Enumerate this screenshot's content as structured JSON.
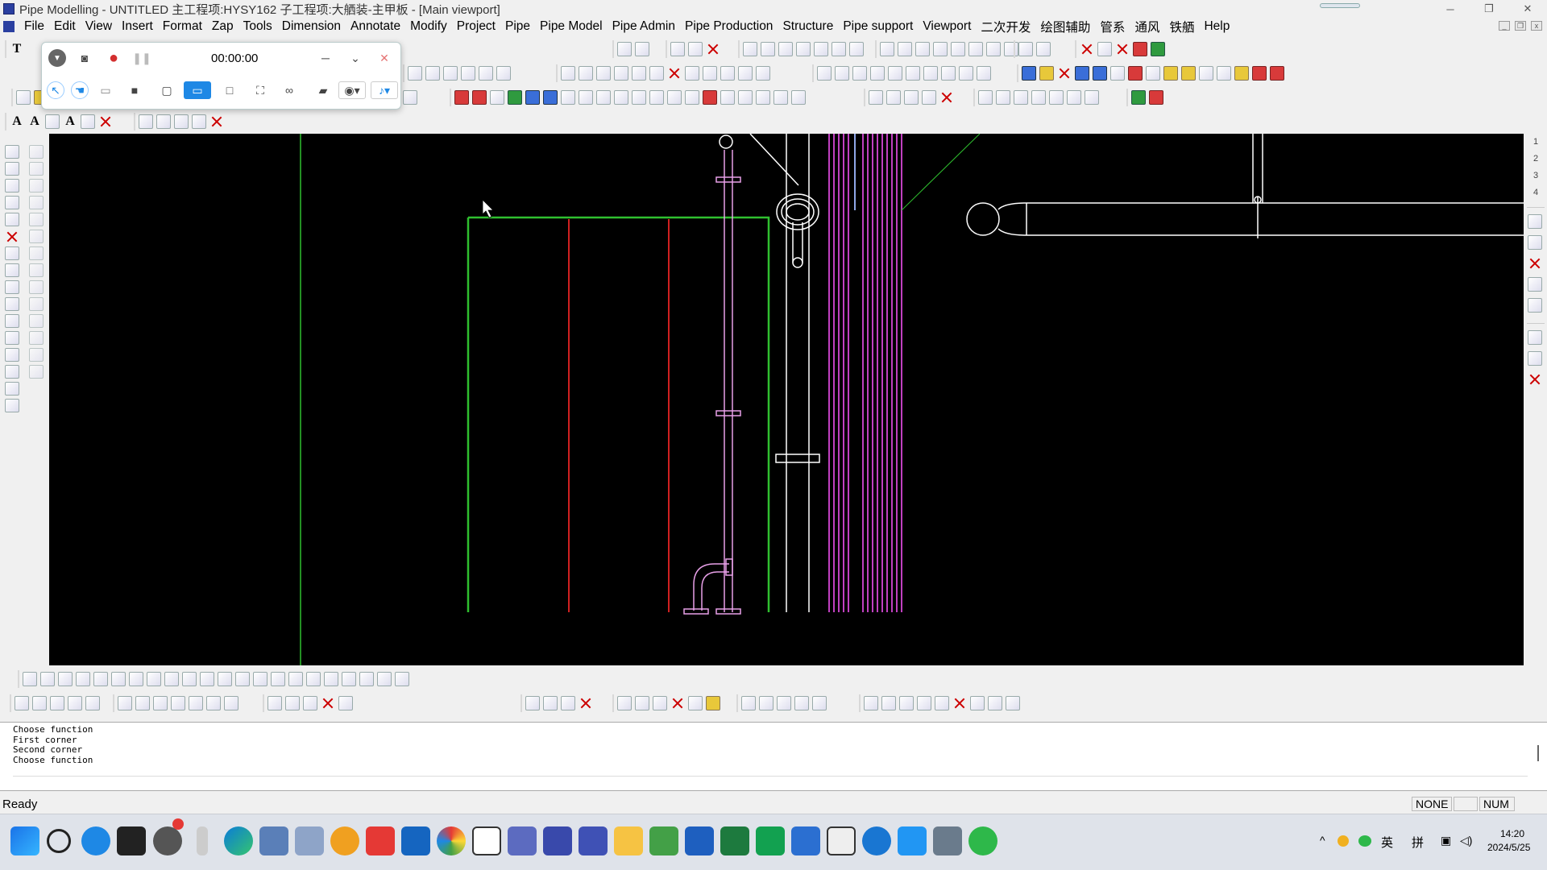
{
  "window": {
    "title": "Pipe Modelling - UNTITLED 主工程项:HYSY162  子工程项:大舾装-主甲板 - [Main viewport]",
    "controls": {
      "minimize": "─",
      "restore": "❐",
      "close": "✕"
    }
  },
  "menu": [
    "File",
    "Edit",
    "View",
    "Insert",
    "Format",
    "Zap",
    "Tools",
    "Dimension",
    "Annotate",
    "Modify",
    "Project",
    "Pipe",
    "Pipe Model",
    "Pipe Admin",
    "Pipe Production",
    "Structure",
    "Pipe support",
    "Viewport",
    "二次开发",
    "绘图辅助",
    "管系",
    "通风",
    "铁舾",
    "Help"
  ],
  "recorder": {
    "timer": "00:00:00",
    "icons": [
      "chevron-down-icon",
      "camera-icon",
      "record-icon",
      "pause-icon",
      "minimize-icon",
      "collapse-icon",
      "close-icon",
      "pointer-icon",
      "hand-icon",
      "keyboard-icon",
      "video-icon",
      "window-icon",
      "screen-icon",
      "region-icon",
      "fullscreen-icon",
      "webcam-icon",
      "folder-icon",
      "webcam-select-icon",
      "microphone-icon"
    ]
  },
  "right_panel": {
    "numbers": [
      "1",
      "2",
      "3",
      "4"
    ]
  },
  "command_line": {
    "lines": [
      "Choose function",
      "First corner",
      "Second corner",
      "Choose function"
    ]
  },
  "status": {
    "message": "Ready",
    "snap": "NONE",
    "num": "NUM"
  },
  "taskbar": {
    "clock_time": "14:20",
    "clock_date": "2024/5/25",
    "ime_lang": "英",
    "ime_mode": "拼",
    "apps": [
      "windows-start-icon",
      "search-icon",
      "edge-legacy-icon",
      "terminal-icon",
      "recorder-app-icon",
      "mouse-icon",
      "edge-icon",
      "network-tool-icon",
      "calculator-icon",
      "search-tool-icon",
      "youdao-icon",
      "pdf-icon",
      "color-picker-icon",
      "text-editor-icon",
      "remote-tool-icon",
      "tt-app-icon",
      "tt-app2-icon",
      "file-explorer-icon",
      "notepad-icon",
      "word-icon",
      "excel-icon",
      "wps-icon",
      "visio-icon",
      "media-icon",
      "app-blue-icon",
      "feishu-icon",
      "pipe-app-icon",
      "wechat-icon"
    ]
  }
}
